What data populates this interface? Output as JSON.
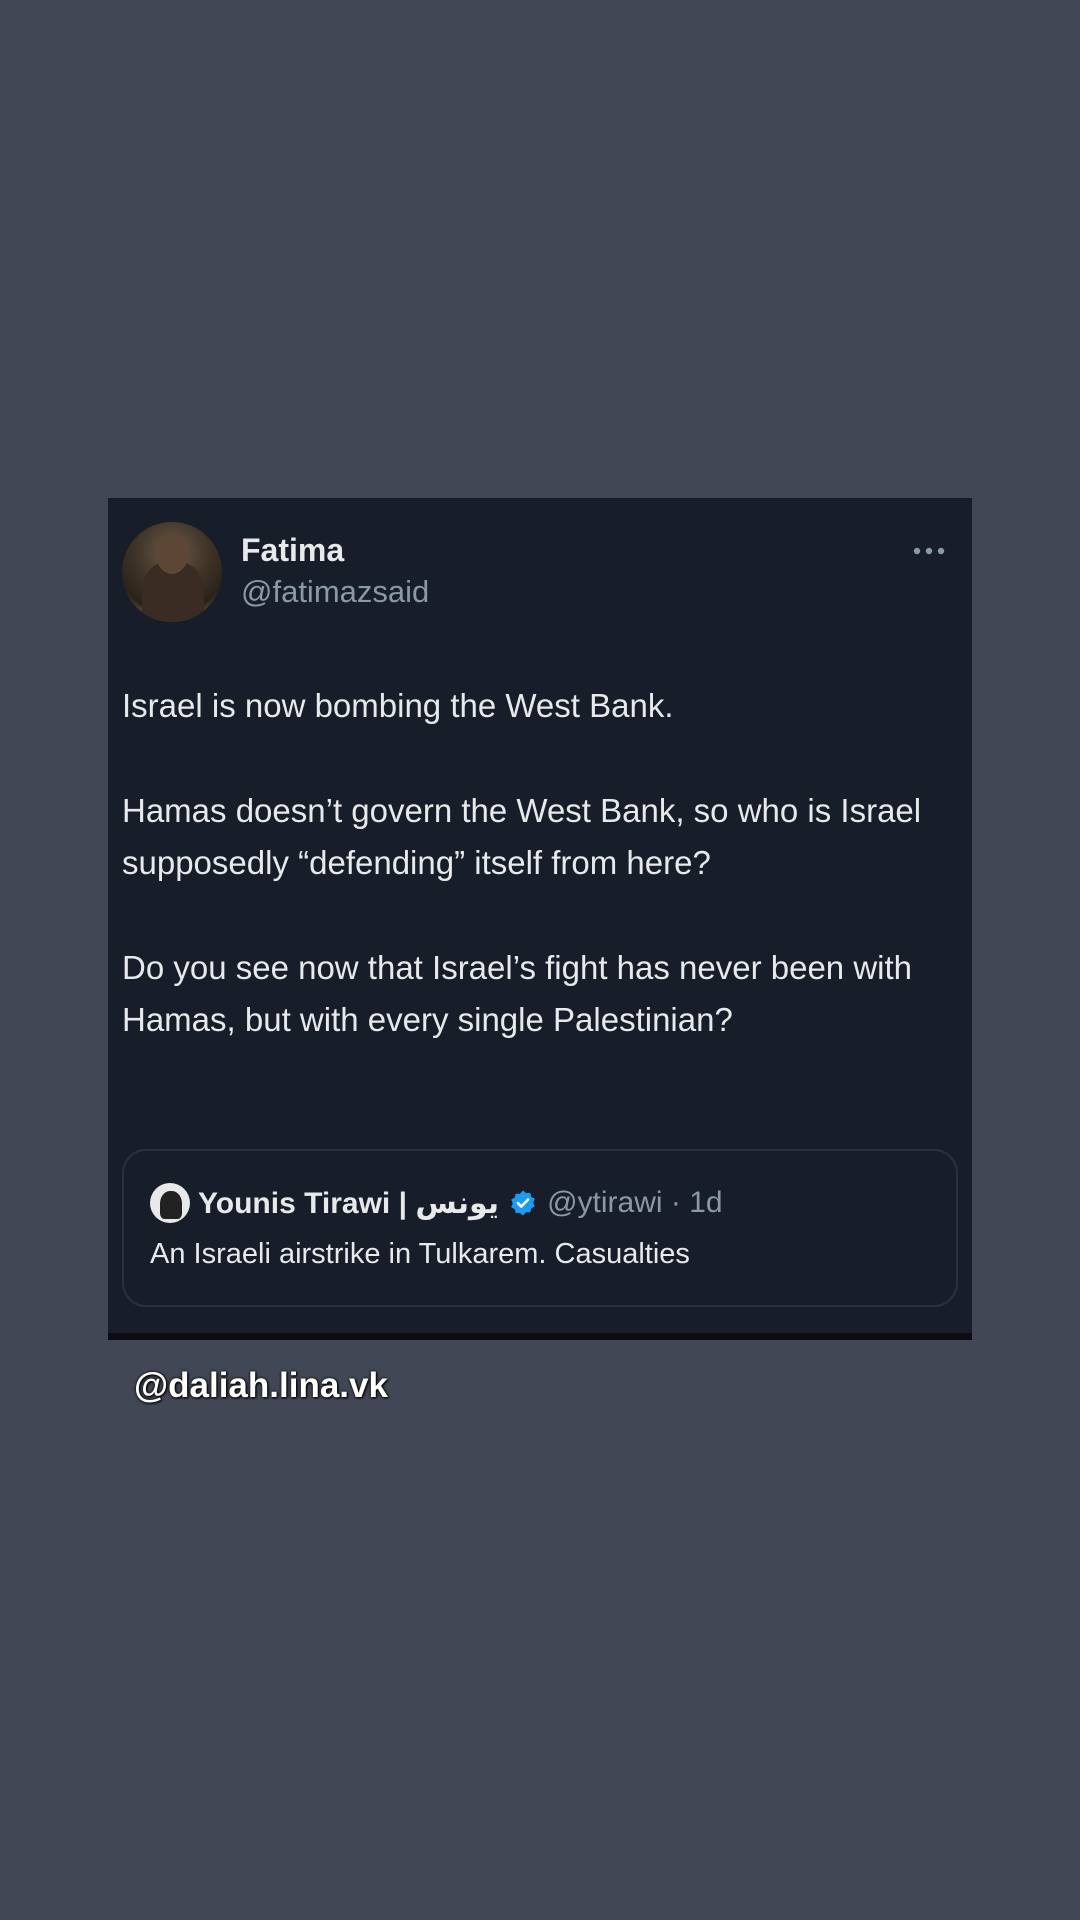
{
  "tweet": {
    "display_name": "Fatima",
    "handle": "@fatimazsaid",
    "more_icon": "more-horizontal-icon",
    "paragraphs": [
      "Israel is now bombing the West Bank.",
      "Hamas doesn’t govern the West Bank, so who is Israel supposedly “defending” itself from here?",
      "Do you see now that Israel’s fight has never been with Hamas, but with every single Palestinian?"
    ],
    "quote": {
      "name": "Younis Tirawi | يونس",
      "verified_icon": "verified-badge-icon",
      "handle_time": "@ytirawi · 1d",
      "text": "An Israeli airstrike in Tulkarem. Casualties"
    }
  },
  "watermark": "@daliah.lina.vk",
  "colors": {
    "background": "#424756",
    "card": "#171d29",
    "primary_text": "#e7e9ea",
    "secondary_text": "#8b98a5",
    "verified_blue": "#1d9bf0"
  }
}
